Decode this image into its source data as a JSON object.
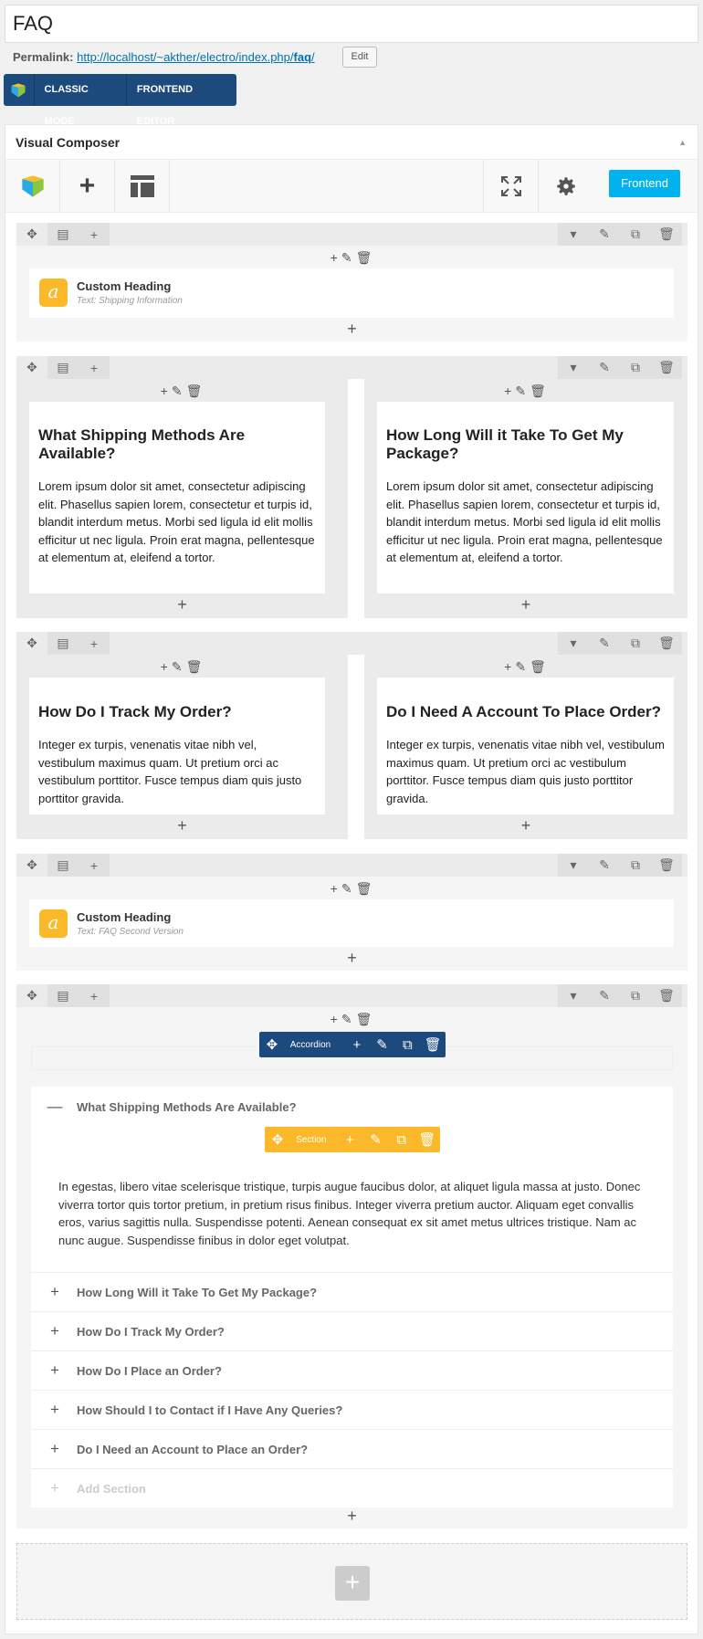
{
  "post_title": "FAQ",
  "permalink": {
    "label": "Permalink:",
    "url_prefix": "http://localhost/~akther/electro/index.php/",
    "slug": "faq",
    "url_suffix": "/",
    "edit_label": "Edit"
  },
  "modes": {
    "classic": "CLASSIC MODE",
    "frontend_editor": "FRONTEND EDITOR"
  },
  "composer": {
    "title": "Visual Composer",
    "frontend_button": "Frontend"
  },
  "heading1": {
    "title": "Custom Heading",
    "subtitle": "Text: Shipping Information"
  },
  "block1": {
    "title": "What Shipping Methods Are Available?",
    "body": "Lorem ipsum dolor sit amet, consectetur adipiscing elit. Phasellus sapien lorem, consectetur et turpis id, blandit interdum metus. Morbi sed ligula id elit mollis efficitur ut nec ligula. Proin erat magna, pellentesque at elementum at, eleifend a tortor."
  },
  "block2": {
    "title": "How Long Will it Take To Get My Package?",
    "body": "Lorem ipsum dolor sit amet, consectetur adipiscing elit. Phasellus sapien lorem, consectetur et turpis id, blandit interdum metus. Morbi sed ligula id elit mollis efficitur ut nec ligula. Proin erat magna, pellentesque at elementum at, eleifend a tortor."
  },
  "block3": {
    "title": "How Do I Track My Order?",
    "body": "Integer ex turpis, venenatis vitae nibh vel, vestibulum maximus quam. Ut pretium orci ac vestibulum porttitor. Fusce tempus diam quis justo porttitor gravida."
  },
  "block4": {
    "title": "Do I Need A Account To Place Order?",
    "body": "Integer ex turpis, venenatis vitae nibh vel, vestibulum maximus quam. Ut pretium orci ac vestibulum porttitor. Fusce tempus diam quis justo porttitor gravida."
  },
  "heading2": {
    "title": "Custom Heading",
    "subtitle": "Text: FAQ Second Version"
  },
  "accordion": {
    "label": "Accordion",
    "section_label": "Section",
    "open_title": "What Shipping Methods Are Available?",
    "open_body": "In egestas, libero vitae scelerisque tristique, turpis augue faucibus dolor, at aliquet ligula massa at justo. Donec viverra tortor quis tortor pretium, in pretium risus finibus. Integer viverra pretium auctor. Aliquam eget convallis eros, varius sagittis nulla. Suspendisse potenti. Aenean consequat ex sit amet metus ultrices tristique. Nam ac nunc augue. Suspendisse finibus in dolor eget volutpat.",
    "items": [
      "How Long Will it Take To Get My Package?",
      "How Do I Track My Order?",
      "How Do I Place an Order?",
      "How Should I to Contact if I Have Any Queries?",
      "Do I Need an Account to Place an Order?"
    ],
    "add_label": "Add Section"
  }
}
